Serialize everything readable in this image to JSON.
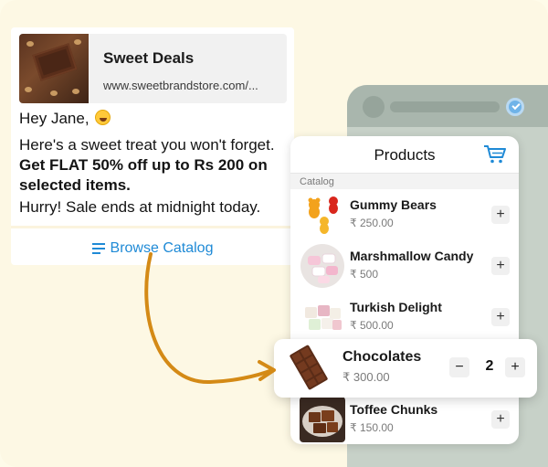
{
  "chat": {
    "link_title": "Sweet Deals",
    "link_url": "www.sweetbrandstore.com/...",
    "greeting": "Hey Jane,",
    "body_line1": "Here's a sweet treat you won't forget.",
    "body_bold": "Get FLAT 50% off up to Rs 200 on selected items.",
    "hurry": "Hurry! Sale ends at midnight today.",
    "browse_label": "Browse Catalog"
  },
  "products": {
    "title": "Products",
    "section_label": "Catalog",
    "items": [
      {
        "name": "Gummy Bears",
        "price": "₹ 250.00",
        "action": "+"
      },
      {
        "name": "Marshmallow Candy",
        "price": "₹ 500",
        "action": "+"
      },
      {
        "name": "Turkish Delight",
        "price": "₹ 500.00",
        "action": "+"
      },
      {
        "name": "Toffee Chunks",
        "price": "₹ 150.00",
        "action": "+"
      }
    ]
  },
  "highlight": {
    "name": "Chocolates",
    "price": "₹ 300.00",
    "minus": "−",
    "quantity": "2",
    "plus": "+"
  },
  "colors": {
    "background": "#fdf8e4",
    "link_blue": "#1f8ad6",
    "arrow": "#d48a16",
    "phone_header": "#a9b6ad",
    "verified": "#6fb3e8"
  },
  "icons": [
    "list-icon",
    "cart-icon",
    "verified-icon",
    "smile-emoji-icon"
  ]
}
